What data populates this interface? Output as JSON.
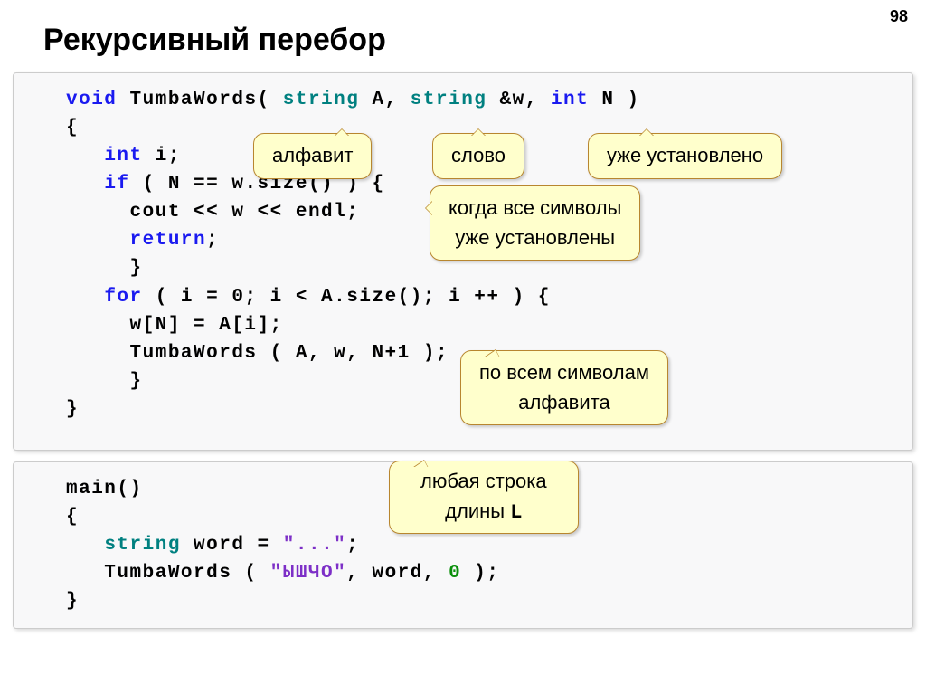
{
  "pageNumber": "98",
  "title": "Рекурсивный перебор",
  "code1": {
    "l1a": "void",
    "l1b": " TumbaWords( ",
    "l1c": "string",
    "l1d": " A, ",
    "l1e": "string",
    "l1f": " &w, ",
    "l1g": "int",
    "l1h": " N )",
    "l2": "{",
    "l3a": "   ",
    "l3b": "int",
    "l3c": " i;",
    "l4a": "   ",
    "l4b": "if",
    "l4c": " ( N == w.size() ) {",
    "l5": "     cout << w << endl;",
    "l6a": "     ",
    "l6b": "return",
    "l6c": ";",
    "l7": "     }",
    "l8a": "   ",
    "l8b": "for",
    "l8c": " ( i = 0; i < A.size(); i ++ ) {",
    "l9": "     w[N] = A[i];",
    "l10": "     TumbaWords ( A, w, N+1 );",
    "l11": "     }",
    "l12": "}"
  },
  "code2": {
    "l1": "main()",
    "l2": "{",
    "l3a": "   ",
    "l3b": "string",
    "l3c": " word = ",
    "l3d": "\"...\"",
    "l3e": ";",
    "l4a": "   TumbaWords ( ",
    "l4b": "\"ЫШЧО\"",
    "l4c": ", word, ",
    "l4d": "0",
    "l4e": " );",
    "l5": "}"
  },
  "balloons": {
    "alphabet": "алфавит",
    "word": "слово",
    "alreadySet": "уже установлено",
    "allSymbols1": "когда все символы",
    "allSymbols2": "уже установлены",
    "allAlpha1": "по всем символам",
    "allAlpha2": "алфавита",
    "anyString1": "любая строка",
    "anyString2": "длины ",
    "anyStringL": "L"
  }
}
